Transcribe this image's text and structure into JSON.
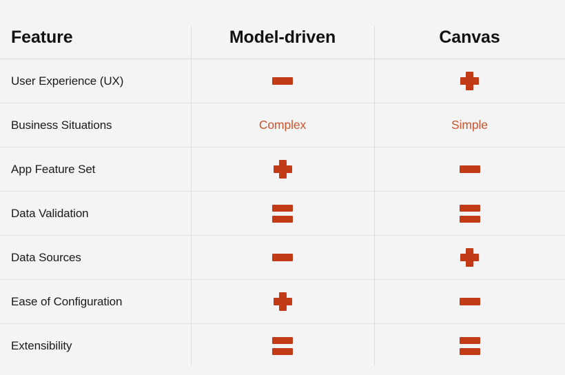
{
  "table": {
    "columns": [
      {
        "key": "feature",
        "label": "Feature",
        "align": "left"
      },
      {
        "key": "model_driven",
        "label": "Model-driven",
        "align": "center"
      },
      {
        "key": "canvas",
        "label": "Canvas",
        "align": "center"
      }
    ],
    "rows": [
      {
        "feature": "User Experience (UX)",
        "model_driven": {
          "kind": "icon",
          "icon": "minus-icon",
          "value": "minus"
        },
        "canvas": {
          "kind": "icon",
          "icon": "plus-icon",
          "value": "plus"
        }
      },
      {
        "feature": "Business Situations",
        "model_driven": {
          "kind": "text",
          "value": "Complex"
        },
        "canvas": {
          "kind": "text",
          "value": "Simple"
        }
      },
      {
        "feature": "App Feature Set",
        "model_driven": {
          "kind": "icon",
          "icon": "plus-icon",
          "value": "plus"
        },
        "canvas": {
          "kind": "icon",
          "icon": "minus-icon",
          "value": "minus"
        }
      },
      {
        "feature": "Data Validation",
        "model_driven": {
          "kind": "icon",
          "icon": "equals-icon",
          "value": "equals"
        },
        "canvas": {
          "kind": "icon",
          "icon": "equals-icon",
          "value": "equals"
        }
      },
      {
        "feature": "Data Sources",
        "model_driven": {
          "kind": "icon",
          "icon": "minus-icon",
          "value": "minus"
        },
        "canvas": {
          "kind": "icon",
          "icon": "plus-icon",
          "value": "plus"
        }
      },
      {
        "feature": "Ease of Configuration",
        "model_driven": {
          "kind": "icon",
          "icon": "plus-icon",
          "value": "plus"
        },
        "canvas": {
          "kind": "icon",
          "icon": "minus-icon",
          "value": "minus"
        }
      },
      {
        "feature": "Extensibility",
        "model_driven": {
          "kind": "icon",
          "icon": "equals-icon",
          "value": "equals"
        },
        "canvas": {
          "kind": "icon",
          "icon": "equals-icon",
          "value": "equals"
        }
      }
    ]
  },
  "colors": {
    "background": "#f4f4f4",
    "accent_symbol": "#c23b16",
    "accent_text": "#c8552e",
    "header_text": "#111111",
    "body_text": "#1a1a1a",
    "rule": "#e2e2e2"
  }
}
